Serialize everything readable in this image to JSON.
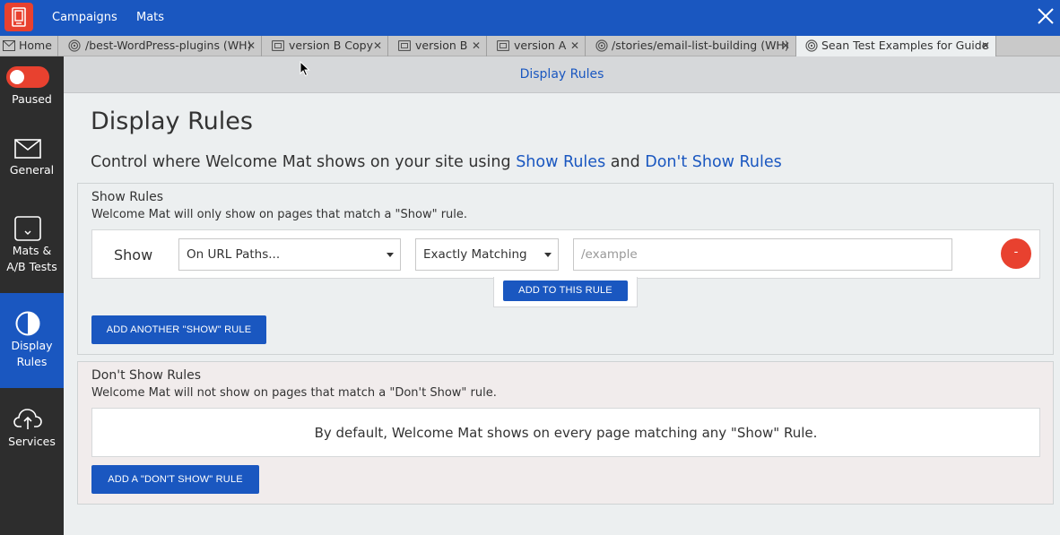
{
  "app": {
    "nav": [
      "Campaigns",
      "Mats"
    ],
    "brand_color": "#1a57c0",
    "accent_color": "#e8412f"
  },
  "tabs": [
    {
      "icon": "envelope-icon",
      "label": "Home",
      "closable": false
    },
    {
      "icon": "target-icon",
      "label": "/best-WordPress-plugins (WH)",
      "closable": true
    },
    {
      "icon": "mat-icon",
      "label": "version B Copy",
      "closable": true
    },
    {
      "icon": "mat-icon",
      "label": "version B",
      "closable": true
    },
    {
      "icon": "mat-icon",
      "label": "version A",
      "closable": true
    },
    {
      "icon": "target-icon",
      "label": "/stories/email-list-building (WH)",
      "closable": true
    },
    {
      "icon": "target-icon",
      "label": "Sean Test Examples for Guide",
      "closable": true,
      "active": true
    }
  ],
  "tab_close_glyph": "✕",
  "sidebar": {
    "status": {
      "label": "Paused",
      "enabled": false
    },
    "items": [
      {
        "icon": "envelope-icon",
        "label": "General"
      },
      {
        "icon": "mats-icon",
        "label": "Mats &",
        "label2": "A/B Tests"
      },
      {
        "icon": "half-circle-icon",
        "label": "Display",
        "label2": "Rules",
        "active": true
      },
      {
        "icon": "cloud-upload-icon",
        "label": "Services"
      }
    ]
  },
  "header": {
    "title": "Display Rules"
  },
  "main": {
    "title": "Display Rules",
    "subtitle_prefix": "Control where Welcome Mat shows on your site using ",
    "subtitle_link1": "Show Rules",
    "subtitle_mid": " and ",
    "subtitle_link2": "Don't Show Rules"
  },
  "show_rules": {
    "title": "Show Rules",
    "description": "Welcome Mat will only show on pages that match a \"Show\" rule.",
    "rule": {
      "label": "Show",
      "target_select": "On URL Paths...",
      "match_select": "Exactly Matching",
      "url_placeholder": "/example",
      "remove_label": "-"
    },
    "add_to_rule_button": "ADD TO THIS RULE",
    "add_another_button": "ADD ANOTHER \"SHOW\" RULE"
  },
  "dont_show_rules": {
    "title": "Don't Show Rules",
    "description": "Welcome Mat will not show on pages that match a \"Don't Show\" rule.",
    "default_message": "By default, Welcome Mat shows on every page matching any \"Show\" Rule.",
    "add_button": "ADD A \"DON'T SHOW\" RULE"
  }
}
